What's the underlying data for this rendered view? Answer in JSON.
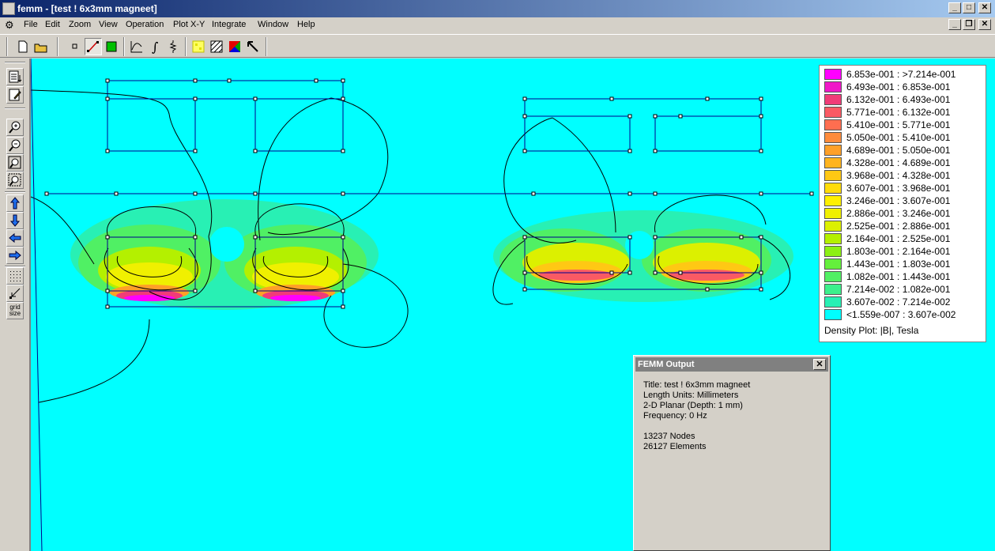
{
  "window": {
    "app_name": "femm",
    "title": "femm - [test ! 6x3mm magneet]"
  },
  "menu": [
    "File",
    "Edit",
    "Zoom",
    "View",
    "Operation",
    "Plot X-Y",
    "Integrate",
    "Window",
    "Help"
  ],
  "toolbar_icons": [
    "new-file-icon",
    "open-file-icon",
    "node-icon",
    "line-icon",
    "block-icon",
    "plot-xy-icon",
    "integrate-icon",
    "circuit-icon",
    "density-plot-icon",
    "hatch-icon",
    "vector-icon",
    "arrow-select-icon"
  ],
  "left_toolbar_icons": [
    "list-icon",
    "edit-note-icon",
    "zoom-in-icon",
    "zoom-out-icon",
    "zoom-natural-icon",
    "zoom-window-icon",
    "pan-up-icon",
    "pan-down-icon",
    "pan-left-icon",
    "pan-right-icon",
    "grid-show-icon",
    "grid-snap-icon"
  ],
  "left_toolbar_grid_label": "grid size",
  "legend": {
    "rows": [
      {
        "label": "6.853e-001 : >7.214e-001",
        "color": "#ff00ff"
      },
      {
        "label": "6.493e-001 : 6.853e-001",
        "color": "#f018c8"
      },
      {
        "label": "6.132e-001 : 6.493e-001",
        "color": "#f03c78"
      },
      {
        "label": "5.771e-001 : 6.132e-001",
        "color": "#fa5a64"
      },
      {
        "label": "5.410e-001 : 5.771e-001",
        "color": "#ff6e50"
      },
      {
        "label": "5.050e-001 : 5.410e-001",
        "color": "#ff8c3c"
      },
      {
        "label": "4.689e-001 : 5.050e-001",
        "color": "#ffa028"
      },
      {
        "label": "4.328e-001 : 4.689e-001",
        "color": "#ffb41e"
      },
      {
        "label": "3.968e-001 : 4.328e-001",
        "color": "#ffc814"
      },
      {
        "label": "3.607e-001 : 3.968e-001",
        "color": "#ffdc0a"
      },
      {
        "label": "3.246e-001 : 3.607e-001",
        "color": "#fff000"
      },
      {
        "label": "2.886e-001 : 3.246e-001",
        "color": "#f0f000"
      },
      {
        "label": "2.525e-001 : 2.886e-001",
        "color": "#dcf000"
      },
      {
        "label": "2.164e-001 : 2.525e-001",
        "color": "#b4f000"
      },
      {
        "label": "1.803e-001 : 2.164e-001",
        "color": "#8cf014"
      },
      {
        "label": "1.443e-001 : 1.803e-001",
        "color": "#64f03c"
      },
      {
        "label": "1.082e-001 : 1.443e-001",
        "color": "#50f064"
      },
      {
        "label": "7.214e-002 : 1.082e-001",
        "color": "#3cf08c"
      },
      {
        "label": "3.607e-002 : 7.214e-002",
        "color": "#28f0b4"
      },
      {
        "label": "<1.559e-007 : 3.607e-002",
        "color": "#00ffff"
      }
    ],
    "title": "Density Plot: |B|, Tesla"
  },
  "output_window": {
    "title": "FEMM Output",
    "lines": [
      "Title: test ! 6x3mm magneet",
      "Length Units: Millimeters",
      "2-D Planar (Depth: 1 mm)",
      "Frequency: 0 Hz",
      "",
      "13237 Nodes",
      "26127 Elements"
    ]
  },
  "colors": {
    "background_field": "#00ffff",
    "geometry_lines": "#00008b",
    "title_active": "#0a246a",
    "title_inactive": "#808080"
  }
}
